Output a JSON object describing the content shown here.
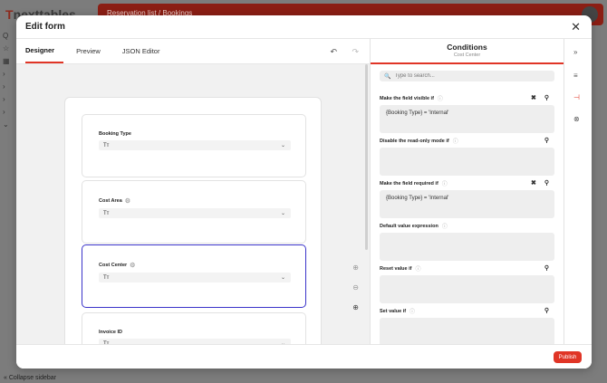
{
  "background": {
    "logo_letter": "T",
    "logo_text": "nexttables",
    "breadcrumb": "Reservation list  /  Bookings",
    "side_items": [
      "Q",
      "☆",
      "▦",
      "›",
      "›",
      "›",
      "›",
      "⌄"
    ],
    "collapse_label": "Collapse sidebar"
  },
  "modal": {
    "title": "Edit form",
    "close_glyph": "✕"
  },
  "designer": {
    "tabs": [
      "Designer",
      "Preview",
      "JSON Editor"
    ],
    "active_tab": 0,
    "undo_glyph": "↶",
    "redo_glyph": "↷",
    "fields": [
      {
        "label": "Booking Type",
        "value": "Tт",
        "has_gear": false,
        "selected": false
      },
      {
        "label": "Cost Area",
        "value": "Tт",
        "has_gear": true,
        "selected": false
      },
      {
        "label": "Cost Center",
        "value": "Tт",
        "has_gear": true,
        "selected": true
      },
      {
        "label": "Invoice ID",
        "value": "Tт",
        "has_gear": false,
        "selected": false
      }
    ],
    "zoom_glyphs": [
      "⊕",
      "⊖",
      "⊕"
    ]
  },
  "conditions": {
    "title": "Conditions",
    "subtitle": "Cost Center",
    "search_placeholder": "Type to search...",
    "items": [
      {
        "label": "Make the field visible if",
        "value": "{Booking Type} = 'Internal'",
        "clear": true,
        "wand": true
      },
      {
        "label": "Disable the read-only mode if",
        "value": "",
        "clear": false,
        "wand": true
      },
      {
        "label": "Make the field required if",
        "value": "{Booking Type} = 'Internal'",
        "clear": true,
        "wand": true
      },
      {
        "label": "Default value expression",
        "value": "",
        "clear": false,
        "wand": false
      },
      {
        "label": "Reset value if",
        "value": "",
        "clear": false,
        "wand": true
      },
      {
        "label": "Set value if",
        "value": "",
        "clear": false,
        "wand": true
      }
    ]
  },
  "footer": {
    "publish_label": "Publish"
  },
  "colors": {
    "accent": "#e03526",
    "selected_border": "#3a33c9",
    "topbar": "#8b1e14"
  }
}
